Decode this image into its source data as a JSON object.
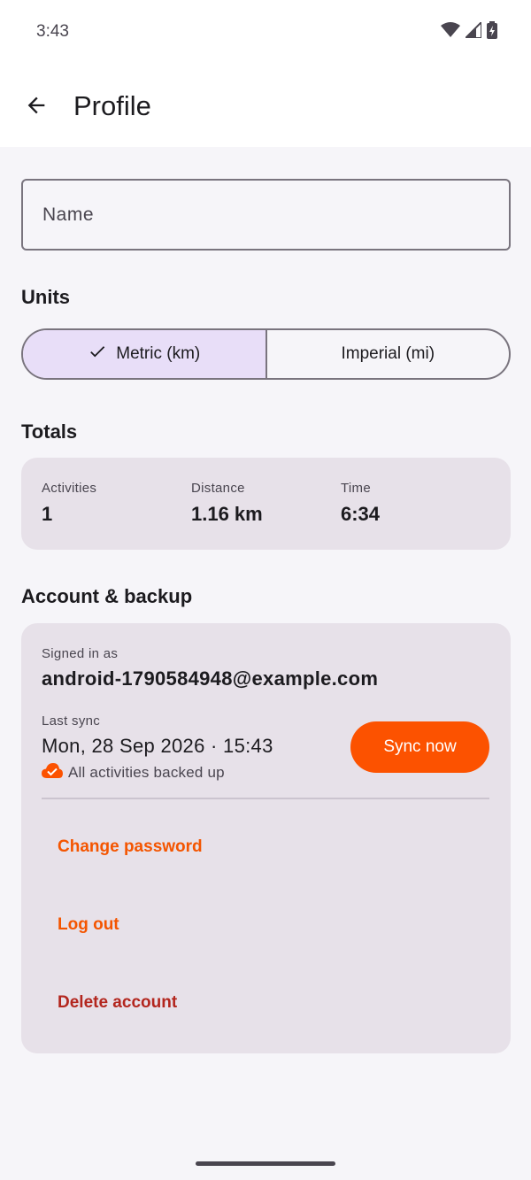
{
  "status_bar": {
    "time": "3:43",
    "icons": [
      "wifi-icon",
      "signal-icon",
      "battery-icon"
    ]
  },
  "app_bar": {
    "back_icon": "arrow-back-icon",
    "title": "Profile"
  },
  "name_field": {
    "placeholder": "Name",
    "value": ""
  },
  "units": {
    "title": "Units",
    "options": [
      {
        "label": "Metric (km)",
        "selected": true
      },
      {
        "label": "Imperial (mi)",
        "selected": false
      }
    ]
  },
  "totals": {
    "title": "Totals",
    "activities_label": "Activities",
    "activities_value": "1",
    "distance_label": "Distance",
    "distance_value": "1.16 km",
    "time_label": "Time",
    "time_value": "6:34"
  },
  "account": {
    "title": "Account & backup",
    "signed_in_label": "Signed in as",
    "email": "android-1790584948@example.com",
    "last_sync_label": "Last sync",
    "last_sync_value": "Mon, 28 Sep 2026 · 15:43",
    "sync_status": "All activities backed up",
    "sync_button": "Sync now",
    "change_password": "Change password",
    "log_out": "Log out",
    "delete_account": "Delete account"
  },
  "colors": {
    "accent": "#fc5200",
    "danger": "#b3261e",
    "selected_segment": "#e8def8",
    "card": "#e7e1e9"
  }
}
